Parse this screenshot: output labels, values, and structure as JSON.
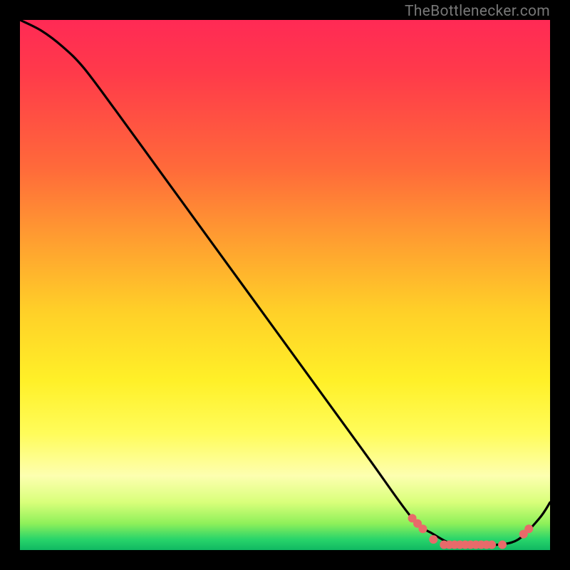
{
  "watermark": "TheBottlenecker.com",
  "chart_data": {
    "type": "line",
    "title": "",
    "xlabel": "",
    "ylabel": "",
    "xlim": [
      0,
      100
    ],
    "ylim": [
      0,
      100
    ],
    "grid": false,
    "series": [
      {
        "name": "curve",
        "x": [
          0,
          4,
          8,
          12,
          18,
          26,
          34,
          42,
          50,
          58,
          66,
          74,
          78,
          82,
          86,
          90,
          94,
          98,
          100
        ],
        "y": [
          100,
          98,
          95,
          91,
          83,
          72,
          61,
          50,
          39,
          28,
          17,
          6,
          3,
          1,
          1,
          1,
          2,
          6,
          9
        ]
      }
    ],
    "markers": [
      {
        "x": 74,
        "y": 6
      },
      {
        "x": 75,
        "y": 5
      },
      {
        "x": 76,
        "y": 4
      },
      {
        "x": 78,
        "y": 2
      },
      {
        "x": 80,
        "y": 1
      },
      {
        "x": 81,
        "y": 1
      },
      {
        "x": 82,
        "y": 1
      },
      {
        "x": 83,
        "y": 1
      },
      {
        "x": 84,
        "y": 1
      },
      {
        "x": 85,
        "y": 1
      },
      {
        "x": 86,
        "y": 1
      },
      {
        "x": 87,
        "y": 1
      },
      {
        "x": 88,
        "y": 1
      },
      {
        "x": 89,
        "y": 1
      },
      {
        "x": 91,
        "y": 1
      },
      {
        "x": 95,
        "y": 3
      },
      {
        "x": 96,
        "y": 4
      }
    ],
    "marker_color": "#e86a6a",
    "line_color": "#000000"
  }
}
